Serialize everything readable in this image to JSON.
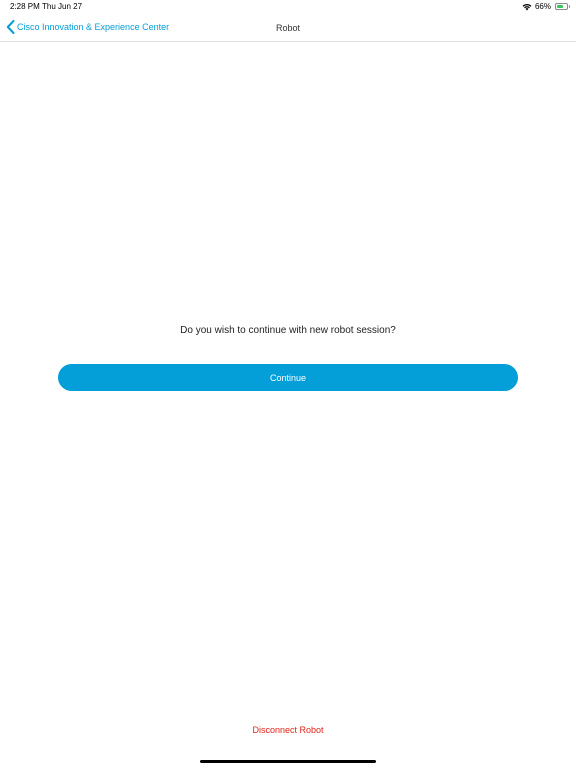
{
  "status_bar": {
    "time": "2:28 PM",
    "date": "Thu Jun 27",
    "battery_percent": "66%",
    "battery_level": 0.66,
    "wifi_icon": "wifi-icon",
    "battery_icon": "battery-icon"
  },
  "nav": {
    "back_label": "Cisco Innovation & Experience Center",
    "back_icon": "chevron-left-icon",
    "title": "Robot"
  },
  "main": {
    "prompt": "Do you wish to continue with new robot session?",
    "continue_label": "Continue"
  },
  "footer": {
    "disconnect_label": "Disconnect Robot"
  },
  "colors": {
    "accent": "#049fd9",
    "danger": "#e2231a",
    "battery": "#34c759"
  }
}
